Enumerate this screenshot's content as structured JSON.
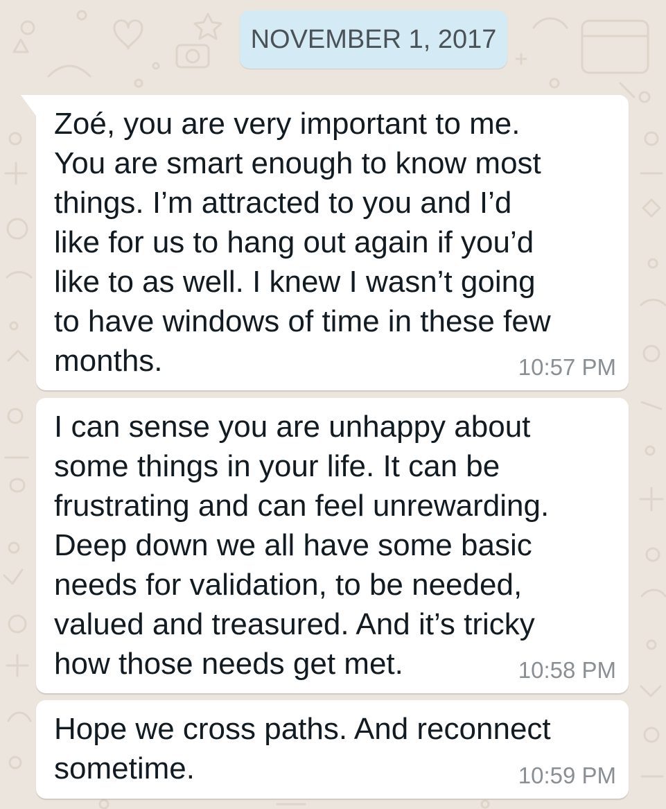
{
  "chat": {
    "date_separator": "NOVEMBER 1, 2017",
    "messages": [
      {
        "text": "Zoé, you are very important to me.\nYou are smart enough to know most\nthings. I’m attracted to you and I’d\nlike for us to hang out again if you’d\nlike to as well. I knew I wasn’t going\nto have windows of time in these few\nmonths.",
        "time": "10:57 PM"
      },
      {
        "text": "I can sense you are unhappy about\nsome things in your life. It can be\nfrustrating and can feel unrewarding.\nDeep down we all have some basic\nneeds for validation, to be needed,\nvalued and treasured. And it’s tricky\nhow those needs get met.",
        "time": "10:58 PM"
      },
      {
        "text": "Hope we cross paths. And reconnect\nsometime.",
        "time": "10:59 PM"
      }
    ]
  },
  "colors": {
    "background": "#ece5dd",
    "date_chip": "#d4eaf4",
    "bubble": "#ffffff",
    "text": "#111b21",
    "timestamp": "#8a8f93"
  },
  "icons": [
    "chat-wallpaper-doodles"
  ]
}
